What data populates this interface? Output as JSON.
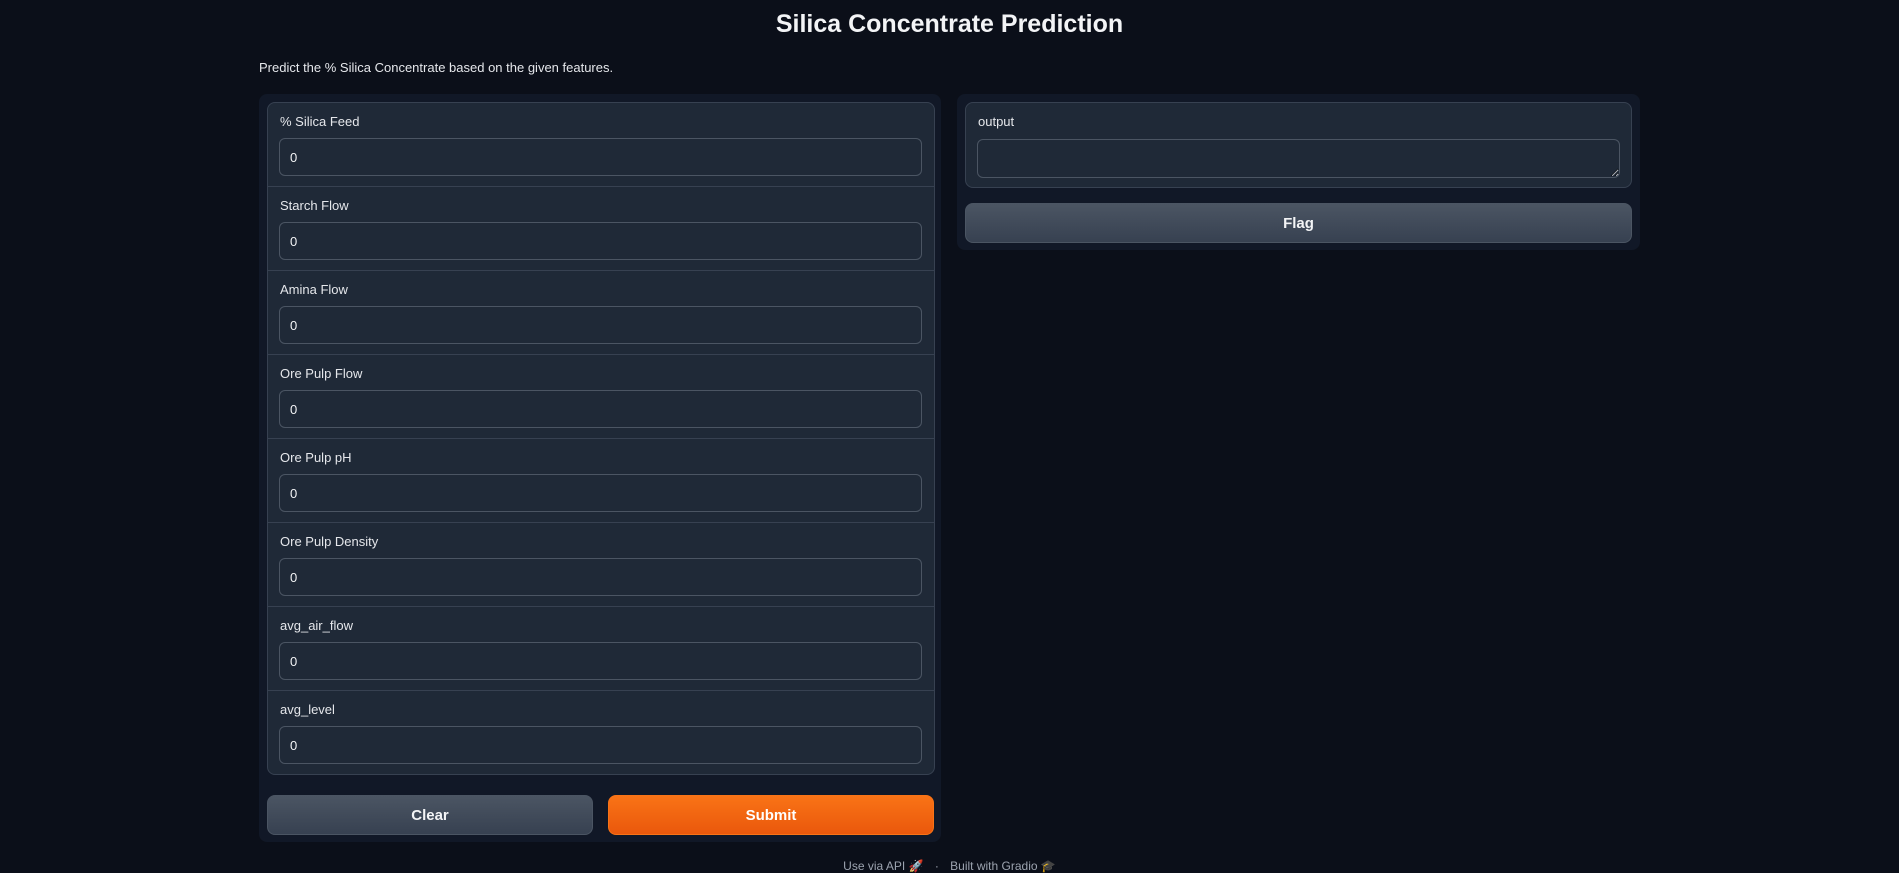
{
  "header": {
    "title": "Silica Concentrate Prediction",
    "description": "Predict the % Silica Concentrate based on the given features."
  },
  "inputs": [
    {
      "label": "% Silica Feed",
      "value": "0"
    },
    {
      "label": "Starch Flow",
      "value": "0"
    },
    {
      "label": "Amina Flow",
      "value": "0"
    },
    {
      "label": "Ore Pulp Flow",
      "value": "0"
    },
    {
      "label": "Ore Pulp pH",
      "value": "0"
    },
    {
      "label": "Ore Pulp Density",
      "value": "0"
    },
    {
      "label": "avg_air_flow",
      "value": "0"
    },
    {
      "label": "avg_level",
      "value": "0"
    }
  ],
  "buttons": {
    "clear": "Clear",
    "submit": "Submit",
    "flag": "Flag"
  },
  "output": {
    "label": "output",
    "value": ""
  },
  "footer": {
    "api_link": "Use via API 🚀",
    "separator": "·",
    "built_with": "Built with Gradio 🎓"
  },
  "colors": {
    "background": "#0b0f19",
    "panel": "#111827",
    "block": "#1f2937",
    "accent": "#f97316",
    "secondary_button": "#4b5563"
  }
}
